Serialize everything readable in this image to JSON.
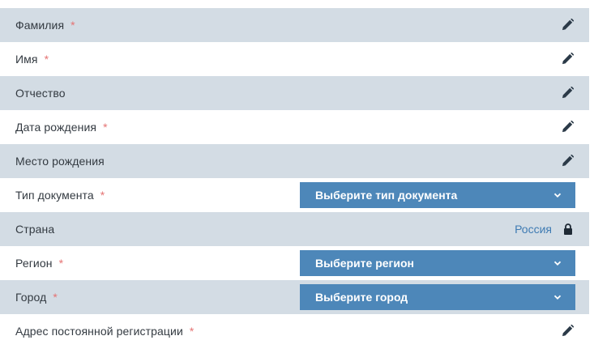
{
  "fields": [
    {
      "label": "Фамилия",
      "required": "*"
    },
    {
      "label": "Имя",
      "required": "*"
    },
    {
      "label": "Отчество"
    },
    {
      "label": "Дата рождения",
      "required": "*"
    },
    {
      "label": "Место рождения"
    },
    {
      "label": "Тип документа",
      "required": "*",
      "select": "Выберите тип документа"
    },
    {
      "label": "Страна",
      "value": "Россия"
    },
    {
      "label": "Регион",
      "required": "*",
      "select": "Выберите регион"
    },
    {
      "label": "Город",
      "required": "*",
      "select": "Выберите город"
    },
    {
      "label": "Адрес постоянной регистрации",
      "required": "*"
    }
  ],
  "icons": {
    "edit": "pencil-icon",
    "dropdown": "chevron-down-icon",
    "locked": "lock-icon"
  },
  "colors": {
    "row_shade": "#d3dce4",
    "select_bg": "#4d87b9",
    "required": "#e57373",
    "link": "#3f7bb3",
    "text": "#333a41"
  }
}
